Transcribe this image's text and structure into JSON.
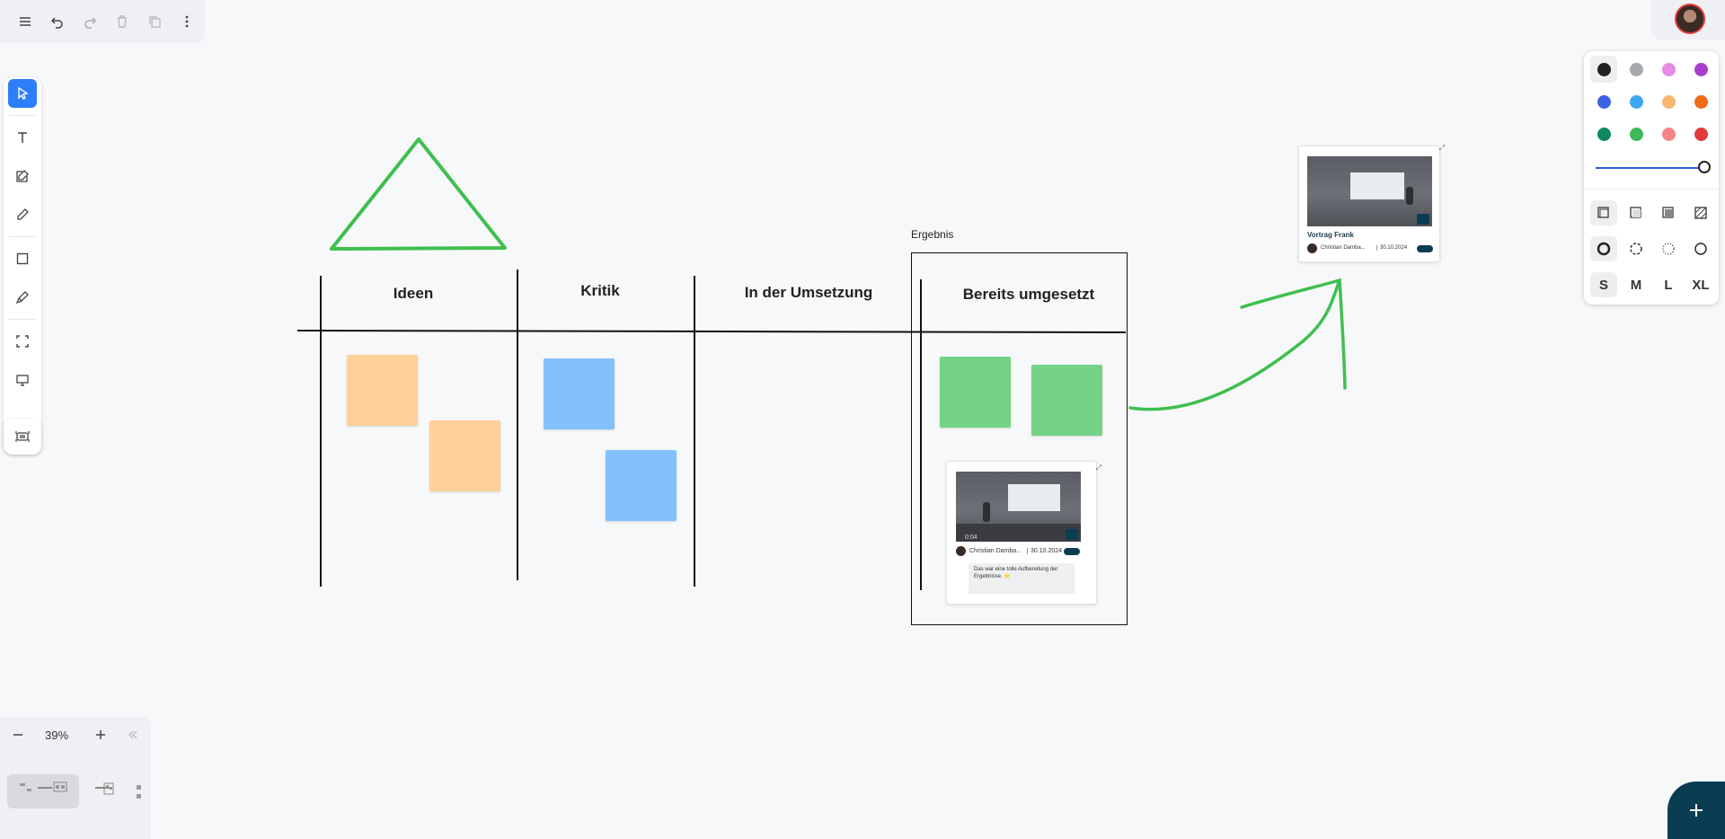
{
  "zoom": {
    "level": "39%"
  },
  "board": {
    "columns": [
      "Ideen",
      "Kritik",
      "In der Umsetzung",
      "Bereits umgesetzt"
    ],
    "frame_label": "Ergebnis"
  },
  "video_card_top": {
    "title": "Vortrag Frank",
    "author": "Christian Damba...",
    "date": "30.10.2024"
  },
  "video_card_bottom": {
    "duration": "0:04",
    "author": "Christian Damba...",
    "date": "30.10.2024",
    "comment": "Das war eine tolle Aufbereitung der Ergebnisse. ⭐"
  },
  "palette": {
    "colors": [
      "#222222",
      "#a6a9ad",
      "#e58be5",
      "#a63ecb",
      "#3d63e3",
      "#3ea6f0",
      "#f7b76c",
      "#f06b1a",
      "#0c8a5e",
      "#3fb859",
      "#f58486",
      "#e23a3a"
    ],
    "sizes": [
      "S",
      "M",
      "L",
      "XL"
    ],
    "selected_size": "S"
  },
  "colors": {
    "accent": "#2d7ff9",
    "fab": "#0b3d52",
    "green": "#3fbf4f",
    "note_orange": "#ffd19a",
    "note_blue": "#84c1fa",
    "note_green": "#74d387"
  },
  "icons": [
    "menu-icon",
    "undo-icon",
    "redo-icon",
    "trash-icon",
    "duplicate-icon",
    "more-icon",
    "select-icon",
    "text-icon",
    "note-icon",
    "pen-icon",
    "rectangle-icon",
    "highlighter-icon",
    "frame-icon",
    "presentation-icon",
    "embed-icon",
    "minus-icon",
    "plus-icon",
    "collapse-icon",
    "add-icon"
  ]
}
